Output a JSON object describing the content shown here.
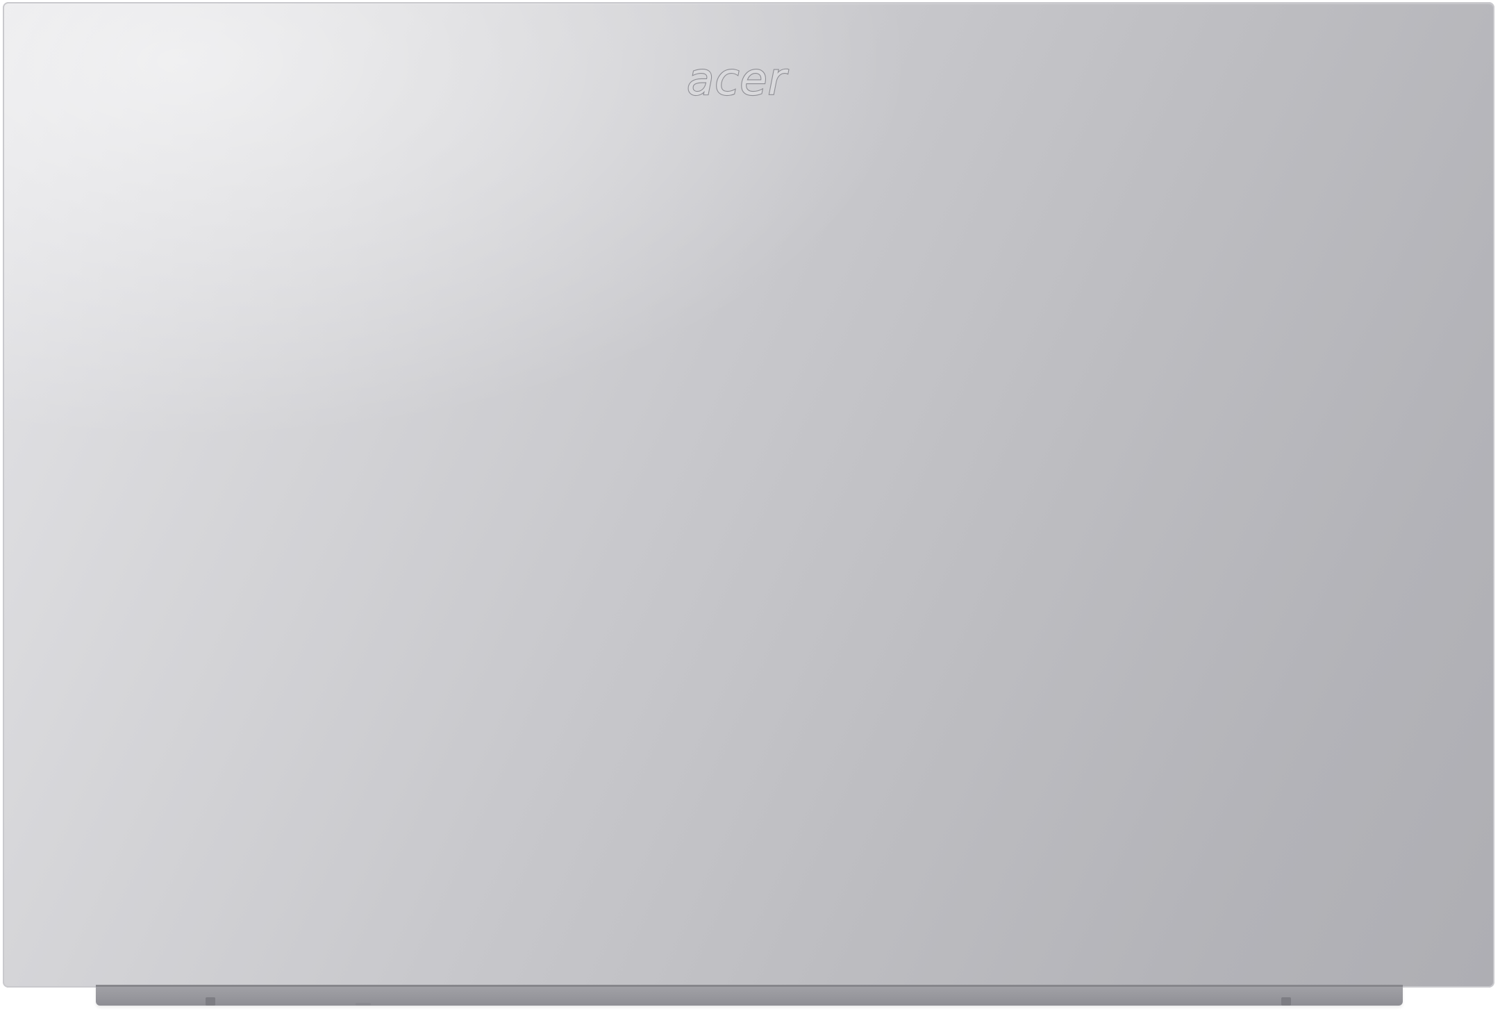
{
  "product": {
    "logo_text": "acer"
  },
  "colors": {
    "lid_light": "#e4e4e7",
    "lid_dark": "#aeaeb3",
    "hinge": "#9a9a9f",
    "logo_fill": "#d9d9dc",
    "logo_outline": "#8d8d93"
  }
}
